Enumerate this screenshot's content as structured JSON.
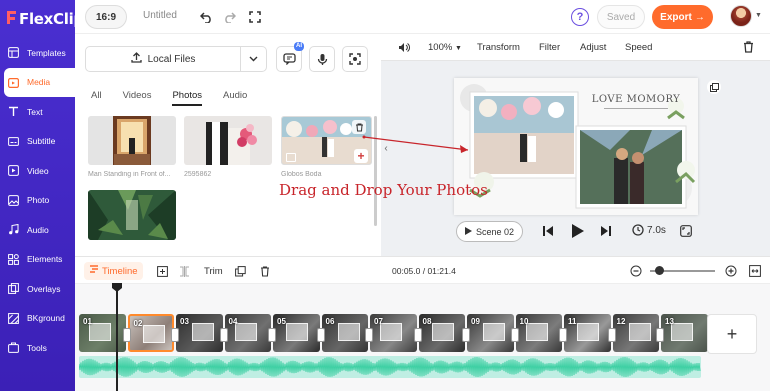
{
  "app": {
    "logo_text": "FlexClip"
  },
  "sidebar": {
    "items": [
      {
        "label": "Templates",
        "icon": "templates-icon"
      },
      {
        "label": "Media",
        "icon": "media-icon",
        "active": true
      },
      {
        "label": "Text",
        "icon": "text-icon"
      },
      {
        "label": "Subtitle",
        "icon": "subtitle-icon"
      },
      {
        "label": "Video",
        "icon": "video-icon"
      },
      {
        "label": "Photo",
        "icon": "photo-icon"
      },
      {
        "label": "Audio",
        "icon": "audio-icon"
      },
      {
        "label": "Elements",
        "icon": "elements-icon"
      },
      {
        "label": "Overlays",
        "icon": "overlays-icon"
      },
      {
        "label": "BKground",
        "icon": "background-icon"
      },
      {
        "label": "Tools",
        "icon": "tools-icon"
      }
    ]
  },
  "topbar": {
    "aspect_ratio": "16:9",
    "project_title": "Untitled",
    "saved_label": "Saved",
    "export_label": "Export",
    "export_arrow": "→",
    "help_label": "?"
  },
  "media": {
    "local_files_label": "Local Files",
    "ai_badge": "AI",
    "tabs": [
      {
        "label": "All"
      },
      {
        "label": "Videos"
      },
      {
        "label": "Photos",
        "active": true
      },
      {
        "label": "Audio"
      }
    ],
    "items": [
      {
        "label": "Man Standing in Front of..."
      },
      {
        "label": "2595862"
      },
      {
        "label": "Globos Boda"
      }
    ]
  },
  "preview": {
    "zoom_level": "100%",
    "toolbar": [
      "Transform",
      "Filter",
      "Adjust",
      "Speed"
    ],
    "canvas_title": "LOVE MOMORY",
    "scene_label": "Scene 02",
    "duration": "7.0s"
  },
  "annotation": {
    "drag_text": "Drag and Drop Your Photos",
    "arrow_color": "#c8252b"
  },
  "timeline": {
    "tab_label": "Timeline",
    "trim_label": "Trim",
    "time_display": "00:05.0 / 01:21.4",
    "clips": [
      "01",
      "02",
      "03",
      "04",
      "05",
      "06",
      "07",
      "08",
      "09",
      "10",
      "11",
      "12",
      "13"
    ],
    "add_label": "+"
  },
  "colors": {
    "brand_purple": "#4a2fd1",
    "accent_orange": "#ff6b2c",
    "audio_green": "#3fd0a4"
  }
}
